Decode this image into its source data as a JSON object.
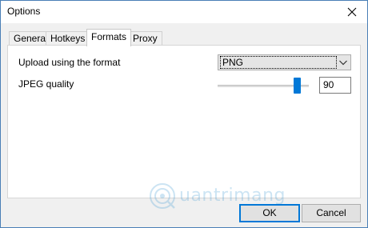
{
  "window": {
    "title": "Options"
  },
  "tabs": [
    {
      "label": "General",
      "active": false
    },
    {
      "label": "Hotkeys",
      "active": false
    },
    {
      "label": "Formats",
      "active": true
    },
    {
      "label": "Proxy",
      "active": false
    }
  ],
  "formats": {
    "upload_label": "Upload using the format",
    "upload_value": "PNG",
    "jpeg_label": "JPEG quality",
    "jpeg_value": "90",
    "jpeg_slider_fraction": 0.9
  },
  "buttons": {
    "ok": "OK",
    "cancel": "Cancel"
  },
  "watermark": {
    "text": "uantrimang"
  },
  "colors": {
    "accent": "#0078d7"
  }
}
